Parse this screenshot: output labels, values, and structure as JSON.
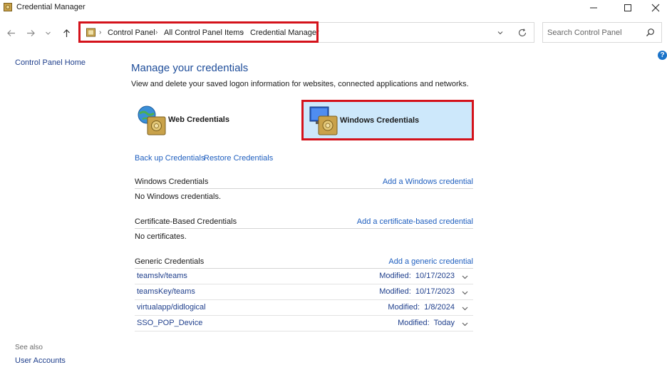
{
  "window": {
    "title": "Credential Manager",
    "icon": "credential-manager-icon"
  },
  "address": {
    "crumbs": [
      "Control Panel",
      "All Control Panel Items",
      "Credential Manager"
    ]
  },
  "search": {
    "placeholder": "Search Control Panel"
  },
  "left_pane": {
    "home_label": "Control Panel Home",
    "see_also_label": "See also",
    "user_accounts_label": "User Accounts"
  },
  "main": {
    "title": "Manage your credentials",
    "description": "View and delete your saved logon information for websites, connected applications and networks.",
    "tiles": {
      "web_label": "Web Credentials",
      "windows_label": "Windows Credentials"
    },
    "backup_label": "Back up Credentials",
    "restore_label": "Restore Credentials",
    "sections": {
      "windows": {
        "title": "Windows Credentials",
        "add_label": "Add a Windows credential",
        "empty_text": "No Windows credentials."
      },
      "certificate": {
        "title": "Certificate-Based Credentials",
        "add_label": "Add a certificate-based credential",
        "empty_text": "No certificates."
      },
      "generic": {
        "title": "Generic Credentials",
        "add_label": "Add a generic credential",
        "items": [
          {
            "name": "teamslv/teams",
            "modified": "Modified:  10/17/2023"
          },
          {
            "name": "teamsKey/teams",
            "modified": "Modified:  10/17/2023"
          },
          {
            "name": "virtualapp/didlogical",
            "modified": "Modified:  1/8/2024"
          },
          {
            "name": "SSO_POP_Device",
            "modified": "Modified:  Today"
          }
        ]
      }
    }
  },
  "colors": {
    "highlight_red": "#d4121b",
    "selected_tile_bg": "#cde8fb",
    "link_blue": "#1f5fbf",
    "title_blue": "#1e4d9a"
  }
}
